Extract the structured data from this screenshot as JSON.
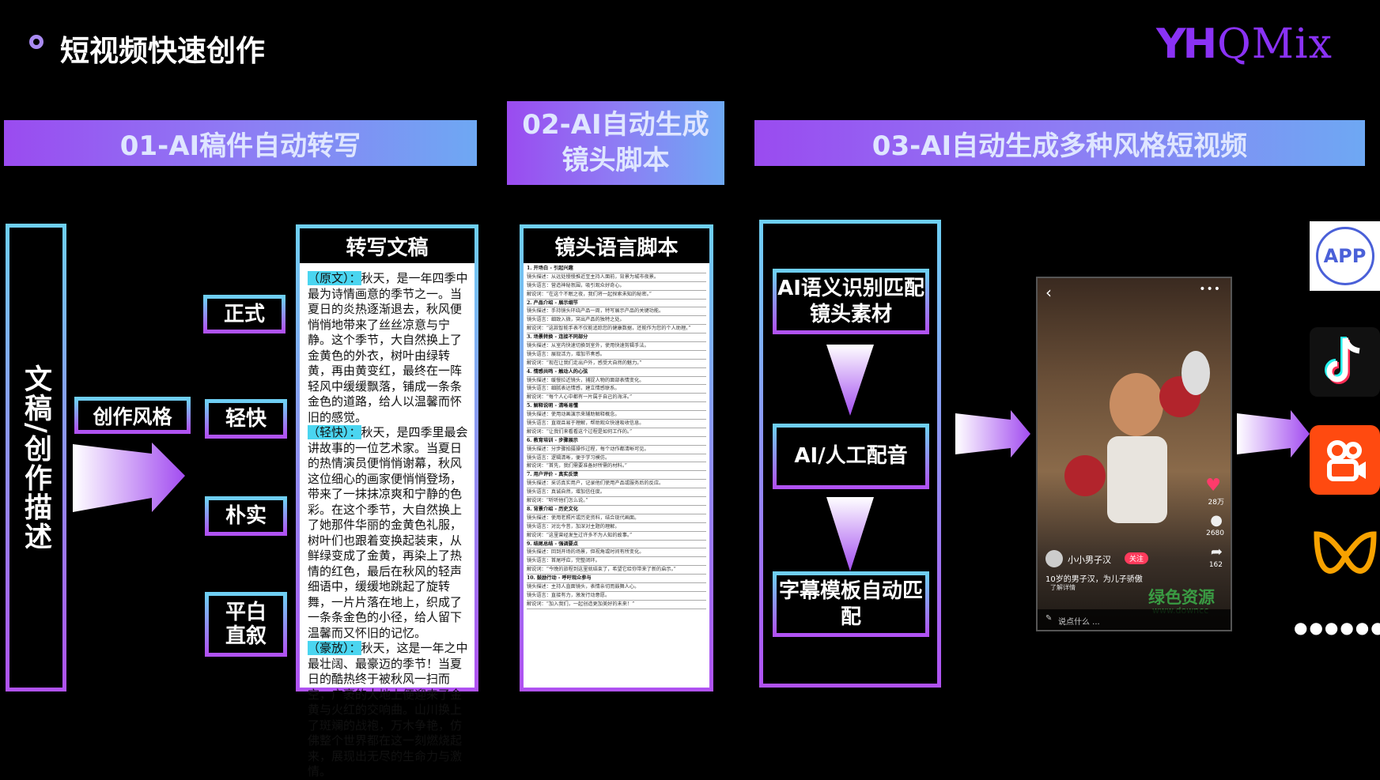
{
  "header": {
    "title": "短视频快速创作",
    "logo": "QMix"
  },
  "banners": {
    "step1": "01-AI稿件自动转写",
    "step2_line1": "02-AI自动生成",
    "step2_line2": "镜头脚本",
    "step3": "03-AI自动生成多种风格短视频"
  },
  "left": {
    "vertical_label": "文稿/创作描述",
    "style_label": "创作风格",
    "options": [
      "正式",
      "轻快",
      "朴实",
      "平白直叙"
    ]
  },
  "doc": {
    "title": "转写文稿",
    "paragraphs": [
      {
        "tag": "（原文）：",
        "text": "秋天，是一年四季中最为诗情画意的季节之一。当夏日的炎热逐渐退去，秋风便悄悄地带来了丝丝凉意与宁静。这个季节，大自然换上了金黄色的外衣，树叶由绿转黄，再由黄变红，最终在一阵轻风中缓缓飘落，铺成一条条金色的道路，给人以温馨而怀旧的感觉。"
      },
      {
        "tag": "（轻快）：",
        "text": "秋天，是四季里最会讲故事的一位艺术家。当夏日的热情演员便悄悄谢幕，秋风这位细心的画家便悄悄登场，带来了一抹抹凉爽和宁静的色彩。在这个季节，大自然换上了她那件华丽的金黄色礼服，树叶们也跟着变换起装束，从鲜绿变成了金黄，再染上了热情的红色，最后在秋风的轻声细语中，缓缓地跳起了旋转舞，一片片落在地上，织成了一条条金色的小径，给人留下温馨而又怀旧的记忆。"
      },
      {
        "tag": "（豪放）：",
        "text": "秋天，这是一年之中最壮阔、最豪迈的季节！当夏日的酷热终于被秋风一扫而空，广袤的大地上便迎来了金黄与火红的交响曲。山川换上了斑斓的战袍，万木争艳，仿佛整个世界都在这一刻燃烧起来，展现出无尽的生命力与激情。"
      }
    ]
  },
  "script": {
    "title": "镜头语言脚本",
    "lines": [
      {
        "t": "1. 开场白 - 引起兴趣",
        "s": true
      },
      {
        "t": "镜头描述：从远处慢慢推近至主持人面前，背景为城市夜景。"
      },
      {
        "t": "镜头语言：营造神秘氛围，吸引观众好奇心。"
      },
      {
        "t": "解说词：“在这个不眠之夜，我们将一起探索未知的秘密。”"
      },
      {
        "t": "2. 产品介绍 - 展示细节",
        "s": true
      },
      {
        "t": "镜头描述：手持镜头环绕产品一周，特写展示产品的关键功能。"
      },
      {
        "t": "镜头语言：细致入微，突出产品的独特之处。"
      },
      {
        "t": "解说词：“这款智能手表不仅能追踪您的健康数据，还能作为您的个人助理。”"
      },
      {
        "t": "3. 场景转换 - 连接不同部分",
        "s": true
      },
      {
        "t": "镜头描述：从室内快速切换到室外，使用快速剪辑手法。"
      },
      {
        "t": "镜头语言：展现活力，增加节奏感。"
      },
      {
        "t": "解说词：“现在让我们走出户外，感受大自然的魅力。”"
      },
      {
        "t": "4. 情感共鸣 - 触动人的心弦",
        "s": true
      },
      {
        "t": "镜头描述：缓慢拉近镜头，捕捉人物的面部表情变化。"
      },
      {
        "t": "镜头语言：细腻表达情感，建立情感联系。"
      },
      {
        "t": "解说词：“每个人心中都有一片属于自己的海洋。”"
      },
      {
        "t": "5. 解释说明 - 清晰易懂",
        "s": true
      },
      {
        "t": "镜头描述：使用动画演示来辅助解释概念。"
      },
      {
        "t": "镜头语言：直观且易于理解，帮助观众快速吸收信息。"
      },
      {
        "t": "解说词：“让我们来看看这个过程是如何工作的。”"
      },
      {
        "t": "6. 教育培训 - 步骤展示",
        "s": true
      },
      {
        "t": "镜头描述：分步骤拍摄操作过程，每个动作都清晰可见。"
      },
      {
        "t": "镜头语言：逻辑清晰，便于学习模仿。"
      },
      {
        "t": "解说词：“首先，我们需要准备好所需的材料。”"
      },
      {
        "t": "7. 用户评价 - 真实反馈",
        "s": true
      },
      {
        "t": "镜头描述：采访真实用户，记录他们使用产品或服务后的反应。"
      },
      {
        "t": "镜头语言：真诚自然，增加信任度。"
      },
      {
        "t": "解说词：“听听他们怎么说。”"
      },
      {
        "t": "8. 背景介绍 - 历史文化",
        "s": true
      },
      {
        "t": "镜头描述：使用老照片或历史资料，结合现代画面。"
      },
      {
        "t": "镜头语言：对比今昔，加深对主题的理解。"
      },
      {
        "t": "解说词：“这里曾经发生过许多不为人知的故事。”"
      },
      {
        "t": "9. 结尾总结 - 强调要点",
        "s": true
      },
      {
        "t": "镜头描述：回到开场的场景，但视角或时间有所变化。"
      },
      {
        "t": "镜头语言：首尾呼应，完整闭环。"
      },
      {
        "t": "解说词：“今晚的旅程到这里就结束了，希望它给你带来了新的启示。”"
      },
      {
        "t": "10. 鼓励行动 - 呼吁观众参与",
        "s": true
      },
      {
        "t": "镜头描述：主持人直面镜头，表情亲切而鼓舞人心。"
      },
      {
        "t": "镜头语言：直接有力，激发行动意愿。"
      },
      {
        "t": "解说词：“加入我们，一起创造更加美好的未来！”"
      }
    ]
  },
  "process": {
    "steps": [
      "AI语义识别匹配镜头素材",
      "AI/人工配音",
      "字幕模板自动匹配"
    ]
  },
  "phone": {
    "user": "小小男子汉",
    "follow": "关注",
    "caption": "10岁的男子汉，为儿子骄傲",
    "sub": "了解详情",
    "comment_placeholder": "说点什么 ...",
    "likes": "28万",
    "comments": "2680",
    "shares": "162",
    "watermark": "绿色资源",
    "watermark_url": "www.downcc"
  },
  "platforms": {
    "app_label": "APP",
    "icons": [
      "app-icon",
      "douyin-icon",
      "kuaishou-icon",
      "wechat-channels-icon"
    ],
    "more": "●●●●●●"
  }
}
